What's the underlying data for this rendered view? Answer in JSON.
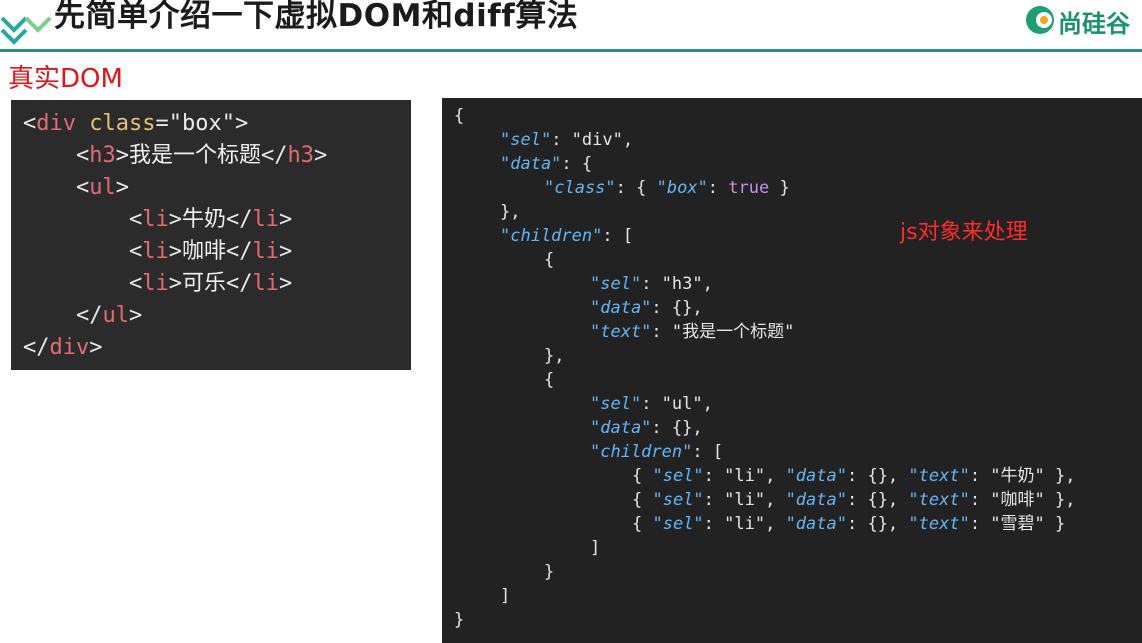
{
  "header": {
    "title": "先简单介绍一下虚拟DOM和diff算法",
    "brand_text": "尚硅谷"
  },
  "subtitle": "真实DOM",
  "html_code": {
    "line1": {
      "open": "<",
      "tag": "div",
      "attr": "class",
      "eq": "=",
      "value": "\"box\"",
      "close": ">"
    },
    "line2": {
      "open": "<",
      "tag": "h3",
      "mid": ">",
      "text": "我是一个标题",
      "open2": "</",
      "tag2": "h3",
      "close": ">"
    },
    "line3": {
      "open": "<",
      "tag": "ul",
      "close": ">"
    },
    "line4": {
      "open": "<",
      "tag": "li",
      "mid": ">",
      "text": "牛奶",
      "open2": "</",
      "tag2": "li",
      "close": ">"
    },
    "line5": {
      "open": "<",
      "tag": "li",
      "mid": ">",
      "text": "咖啡",
      "open2": "</",
      "tag2": "li",
      "close": ">"
    },
    "line6": {
      "open": "<",
      "tag": "li",
      "mid": ">",
      "text": "可乐",
      "open2": "</",
      "tag2": "li",
      "close": ">"
    },
    "line7": {
      "open": "</",
      "tag": "ul",
      "close": ">"
    },
    "line8": {
      "open": "</",
      "tag": "div",
      "close": ">"
    }
  },
  "json_code": {
    "l1": "{",
    "l2": {
      "key": "\"sel\"",
      "rest": ": \"div\","
    },
    "l3": {
      "key": "\"data\"",
      "rest": ": {"
    },
    "l4": {
      "key": "\"class\"",
      "mid": ": { ",
      "key2": "\"box\"",
      "mid2": ": ",
      "bool": "true",
      "rest": " }"
    },
    "l5": "},",
    "l6": {
      "key": "\"children\"",
      "rest": ": ["
    },
    "l7": "{",
    "l8": {
      "key": "\"sel\"",
      "rest": ": \"h3\","
    },
    "l9": {
      "key": "\"data\"",
      "rest": ": {},"
    },
    "l10": {
      "key": "\"text\"",
      "rest": ": \"我是一个标题\""
    },
    "l11": "},",
    "l12": "{",
    "l13": {
      "key": "\"sel\"",
      "rest": ": \"ul\","
    },
    "l14": {
      "key": "\"data\"",
      "rest": ": {},"
    },
    "l15": {
      "key": "\"children\"",
      "rest": ": ["
    },
    "l16": {
      "p1": "{ ",
      "k1": "\"sel\"",
      "p2": ": \"li\", ",
      "k2": "\"data\"",
      "p3": ": {}, ",
      "k3": "\"text\"",
      "p4": ": \"牛奶\" },"
    },
    "l17": {
      "p1": "{ ",
      "k1": "\"sel\"",
      "p2": ": \"li\", ",
      "k2": "\"data\"",
      "p3": ": {}, ",
      "k3": "\"text\"",
      "p4": ": \"咖啡\" },"
    },
    "l18": {
      "p1": "{ ",
      "k1": "\"sel\"",
      "p2": ": \"li\", ",
      "k2": "\"data\"",
      "p3": ": {}, ",
      "k3": "\"text\"",
      "p4": ": \"雪碧\" }"
    },
    "l19": "]",
    "l20": "}",
    "l21": "]",
    "l22": "}"
  },
  "annotation": "js对象来处理",
  "colors": {
    "header_line": "#2d8b82",
    "subtitle": "#e1141a",
    "annotation": "#ff2a2a",
    "html_tag": "#e06c75",
    "html_attr": "#e5c07b",
    "json_key": "#64b5f6",
    "json_bool": "#c792ea",
    "panel_bg": "#2b2b2b"
  }
}
